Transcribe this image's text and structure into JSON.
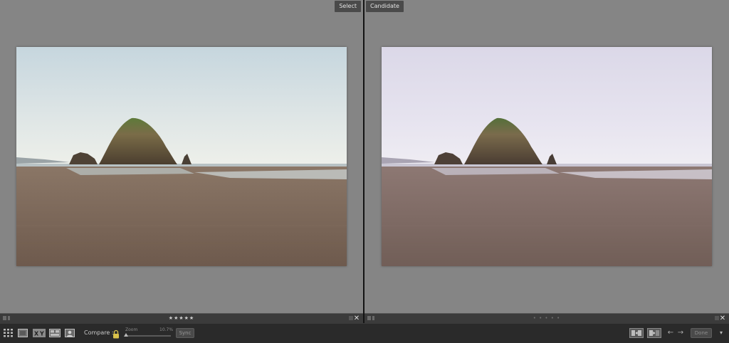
{
  "panes": {
    "select_label": "Select",
    "candidate_label": "Candidate"
  },
  "left_footer": {
    "rating": "★★★★★",
    "close": "✕"
  },
  "right_footer": {
    "rating": "• • • • •",
    "close": "✕"
  },
  "toolbar": {
    "compare_label": "Compare :",
    "zoom_label": "Zoom",
    "zoom_value": "10.7%",
    "zoom_level_fraction": 0.02,
    "sync_label": "Sync",
    "prev_label": "←",
    "next_label": "→",
    "done_label": "Done",
    "menu_label": "▾"
  },
  "colors": {
    "select_sky_top": "#c4d4dc",
    "select_sand": "#7a6657",
    "candidate_sky_top": "#d8d6e6",
    "candidate_sand": "#7b6662"
  },
  "icons": [
    "grid-view-icon",
    "loupe-view-icon",
    "compare-view-icon",
    "survey-view-icon",
    "people-view-icon",
    "lock-icon",
    "swap-icon",
    "make-select-icon"
  ]
}
